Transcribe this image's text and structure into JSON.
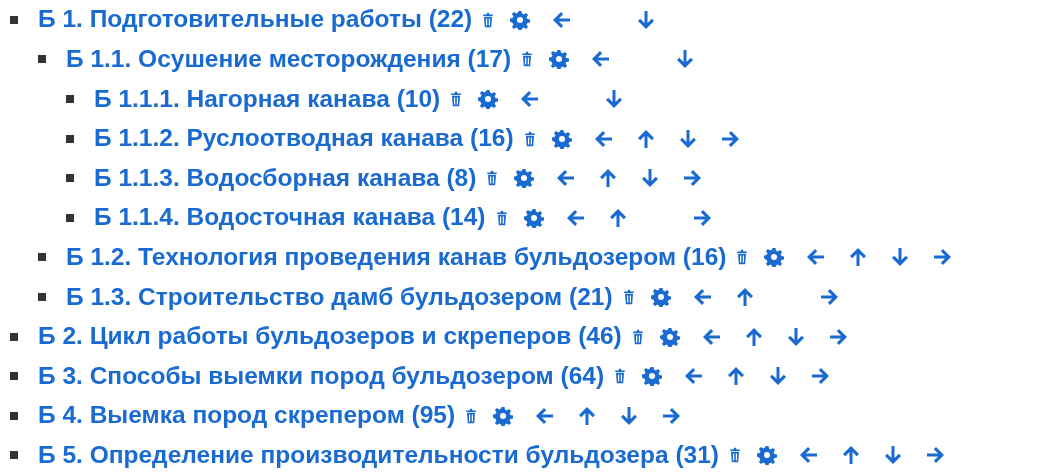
{
  "tree": [
    {
      "label": "Б 1. Подготовительные работы (22)",
      "up": false,
      "down": true,
      "right": false,
      "children": [
        {
          "label": "Б 1.1. Осушение месторождения (17)",
          "up": false,
          "down": true,
          "right": false,
          "children": [
            {
              "label": "Б 1.1.1. Нагорная канава (10)",
              "up": false,
              "down": true,
              "right": false
            },
            {
              "label": "Б 1.1.2. Руслоотводная канава (16)",
              "up": true,
              "down": true,
              "right": true
            },
            {
              "label": "Б 1.1.3. Водосборная канава (8)",
              "up": true,
              "down": true,
              "right": true
            },
            {
              "label": "Б 1.1.4. Водосточная канава (14)",
              "up": true,
              "down": false,
              "right": true
            }
          ]
        },
        {
          "label": "Б 1.2. Технология проведения канав бульдозером (16)",
          "up": true,
          "down": true,
          "right": true
        },
        {
          "label": "Б 1.3. Строительство дамб бульдозером (21)",
          "up": true,
          "down": false,
          "right": true
        }
      ]
    },
    {
      "label": "Б 2. Цикл работы бульдозеров и скреперов (46)",
      "up": true,
      "down": true,
      "right": true
    },
    {
      "label": "Б 3. Способы выемки пород бульдозером (64)",
      "up": true,
      "down": true,
      "right": true
    },
    {
      "label": "Б 4. Выемка пород скрепером (95)",
      "up": true,
      "down": true,
      "right": true
    },
    {
      "label": "Б 5. Определение производительности бульдозера (31)",
      "up": true,
      "down": true,
      "right": true
    }
  ]
}
